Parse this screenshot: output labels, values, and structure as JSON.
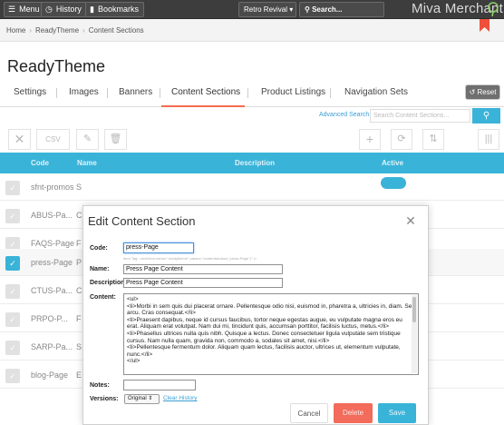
{
  "topbar": {
    "menu_label": "Menu",
    "history_label": "History",
    "bookmarks_label": "Bookmarks",
    "store_selector": "Retro Revival",
    "search_label": "Search...",
    "brand": "Miva Merchant"
  },
  "breadcrumb": [
    "Home",
    "ReadyTheme",
    "Content Sections"
  ],
  "page_title": "ReadyTheme",
  "tabs": [
    "Settings",
    "Images",
    "Banners",
    "Content Sections",
    "Product Listings",
    "Navigation Sets"
  ],
  "active_tab": "Content Sections",
  "reset_label": "Reset",
  "advanced_search_label": "Advanced Search",
  "search_placeholder": "Search Content Sections...",
  "toolbar": {
    "csv_label": "CSV"
  },
  "table": {
    "headers": {
      "code": "Code",
      "name": "Name",
      "description": "Description",
      "active": "Active"
    },
    "rows": [
      {
        "code": "sfnt-promos",
        "name": "S",
        "checked": false
      },
      {
        "code": "ABUS-Pa...",
        "name": "C",
        "checked": false
      },
      {
        "code": "FAQS-Page",
        "name": "F",
        "checked": false
      },
      {
        "code": "press-Page",
        "name": "P",
        "checked": true
      },
      {
        "code": "CTUS-Pa...",
        "name": "C",
        "checked": false
      },
      {
        "code": "PRPO-P...",
        "name": "F",
        "checked": false
      },
      {
        "code": "SARP-Pa...",
        "name": "S",
        "checked": false
      },
      {
        "code": "blog-Page",
        "name": "E",
        "checked": false
      }
    ]
  },
  "modal": {
    "title": "Edit Content Section",
    "code_label": "Code:",
    "code_value": "press-Page",
    "item_tag_hint": "Item Tag: <mvt:item name=\"readytheme\" param=\"contentsection( 'press-Page' )\" />",
    "name_label": "Name:",
    "name_value": "Press Page Content",
    "description_label": "Description:",
    "description_value": "Press Page Content",
    "content_label": "Content:",
    "content_lines": [
      "<ul>",
      "  <li>Morbi in sem quis dui placerat ornare. Pellentesque odio nisi, euismod in, pharetra a, ultricies in, diam. Sed arcu. Cras consequat.</li>",
      "  <li>Praesent dapibus, neque id cursus faucibus, tortor neque egestas augue, eu vulputate magna eros eu erat. Aliquam erat volutpat. Nam dui mi, tincidunt quis, accumsan porttitor, facilisis luctus, metus.</li>",
      "  <li>Phasellus ultrices nulla quis nibh. Quisque a lectus. Donec consectetuer ligula vulputate sem tristique cursus. Nam nulla quam, gravida non, commodo a, sodales sit amet, nisi.</li>",
      "  <li>Pellentesque fermentum dolor. Aliquam quam lectus, facilisis auctor, ultrices ut, elementum vulputate, nunc.</li>",
      "</ul>"
    ],
    "notes_label": "Notes:",
    "notes_value": "",
    "versions_label": "Versions:",
    "versions_value": "Original",
    "clear_history_label": "Clear History",
    "cancel_label": "Cancel",
    "delete_label": "Delete",
    "save_label": "Save"
  },
  "colors": {
    "accent": "#3ab3d8",
    "tab_underline": "#f56d4e",
    "delete": "#f26b5b",
    "topbar": "#3d3d3d"
  }
}
